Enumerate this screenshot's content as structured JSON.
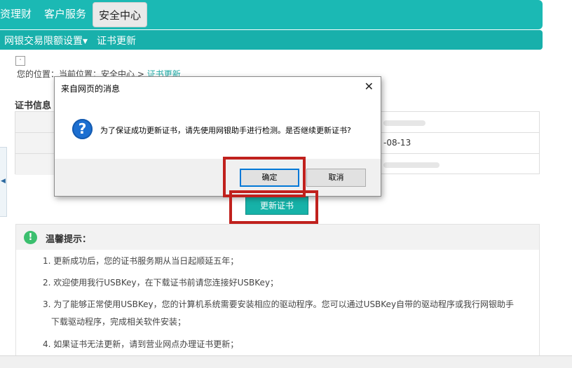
{
  "topnav": {
    "tabs": [
      {
        "label": "资理财"
      },
      {
        "label": "客户服务"
      },
      {
        "label": "安全中心",
        "active": true
      }
    ]
  },
  "subnav": {
    "items": [
      {
        "label": "网银交易限额设置▾"
      },
      {
        "label": "证书更新"
      }
    ]
  },
  "breadcrumb": {
    "prefix": "您的位置：当前位置：安全中心 > ",
    "current": "证书更新"
  },
  "cert_info": {
    "title": "证书信息",
    "rows": [
      {
        "value": ""
      },
      {
        "value": "-08-13"
      },
      {
        "value": ""
      }
    ]
  },
  "update_button": "更新证书",
  "tips": {
    "title": "温馨提示：",
    "items": [
      "1. 更新成功后，您的证书服务期从当日起顺延五年；",
      "2. 欢迎使用我行USBKey，在下载证书前请您连接好USBKey；",
      "3. 为了能够正常使用USBKey，您的计算机系统需要安装相应的驱动程序。您可以通过USBKey自带的驱动程序或我行网银助手",
      "下载驱动程序，完成相关软件安装；",
      "4. 如果证书无法更新，请到营业网点办理证书更新；"
    ]
  },
  "dialog": {
    "title": "来自网页的消息",
    "message": "为了保证成功更新证书，请先使用网银助手进行检测。是否继续更新证书?",
    "ok_label": "确定",
    "cancel_label": "取消",
    "close_glyph": "✕",
    "icon": "question-icon"
  },
  "colors": {
    "accent": "#1bb9b4",
    "highlight": "#c0211d",
    "dialog_icon": "#1c6fd1"
  }
}
